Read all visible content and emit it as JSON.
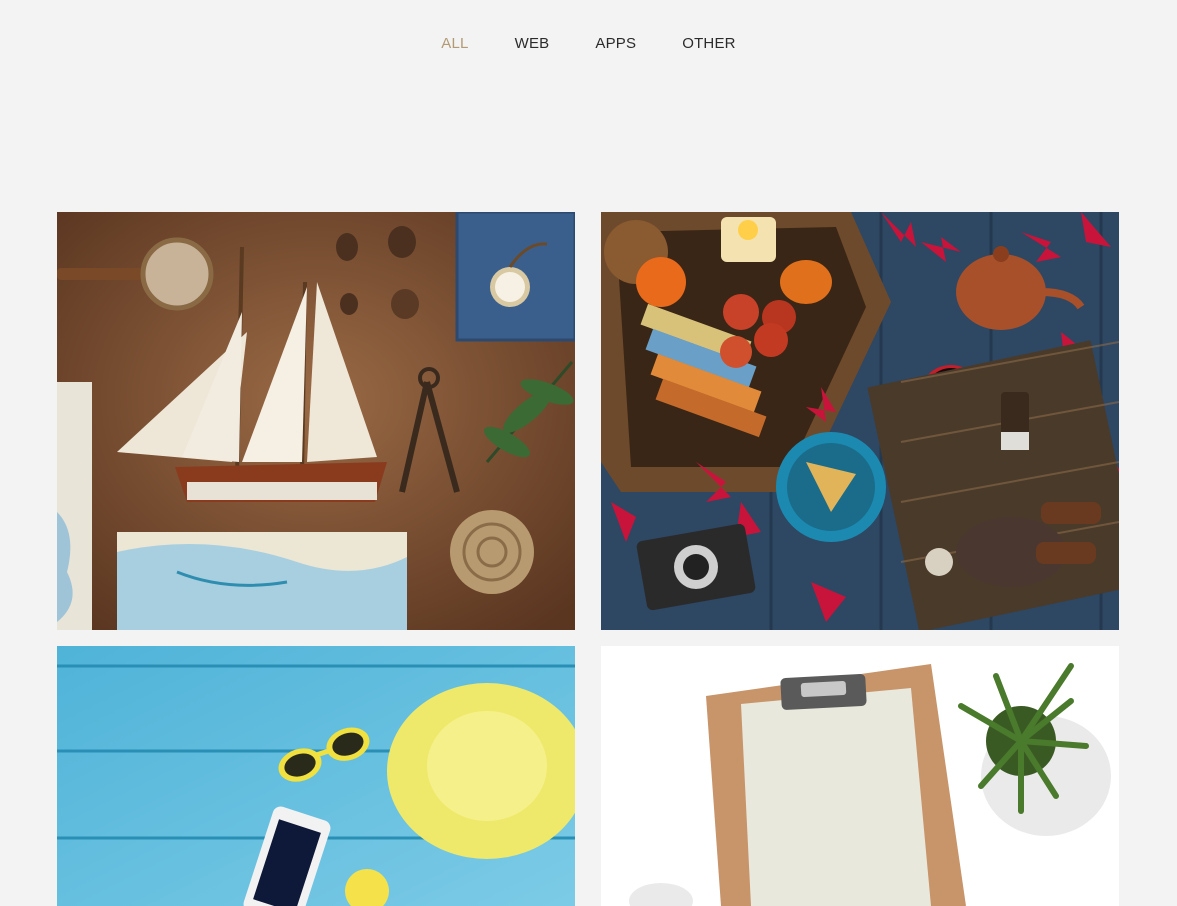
{
  "filters": [
    {
      "label": "ALL",
      "active": true
    },
    {
      "label": "WEB",
      "active": false
    },
    {
      "label": "APPS",
      "active": false
    },
    {
      "label": "OTHER",
      "active": false
    }
  ],
  "colors": {
    "background": "#f3f3f3",
    "active_filter": "#b39a74",
    "filter_text": "#2b2b2b"
  },
  "portfolio": [
    {
      "subject": "nautical-flatlay"
    },
    {
      "subject": "autumn-tea-flatlay"
    },
    {
      "subject": "summer-beach-flatlay"
    },
    {
      "subject": "clipboard-plant-flatlay"
    }
  ]
}
